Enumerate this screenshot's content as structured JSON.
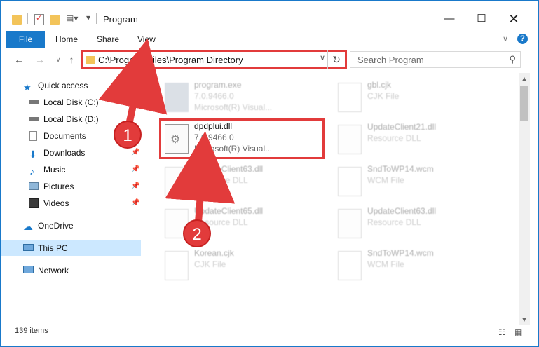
{
  "window": {
    "title": "Program"
  },
  "ribbon": {
    "tabs": [
      "File",
      "Home",
      "Share",
      "View"
    ]
  },
  "address": {
    "path": "C:\\Program Files\\Program Directory"
  },
  "search": {
    "placeholder": "Search Program"
  },
  "nav": {
    "items": [
      {
        "label": "Quick access",
        "icon": "star-icon"
      },
      {
        "label": "Local Disk (C:)",
        "icon": "drive-icon"
      },
      {
        "label": "Local Disk (D:)",
        "icon": "drive-icon"
      },
      {
        "label": "Documents",
        "icon": "documents-icon"
      },
      {
        "label": "Downloads",
        "icon": "download-icon"
      },
      {
        "label": "Music",
        "icon": "music-icon"
      },
      {
        "label": "Pictures",
        "icon": "pictures-icon"
      },
      {
        "label": "Videos",
        "icon": "videos-icon"
      },
      {
        "label": "OneDrive",
        "icon": "cloud-icon"
      },
      {
        "label": "This PC",
        "icon": "computer-icon"
      },
      {
        "label": "Network",
        "icon": "network-icon"
      }
    ]
  },
  "files": {
    "left": [
      {
        "name": "program.exe",
        "line1": "7.0.9466.0",
        "line2": "Microsoft(R) Visual..."
      },
      {
        "name": "dpdplui.dll",
        "line1": "7.0.9466.0",
        "line2": "Microsoft(R) Visual..."
      },
      {
        "name": "UpdateClient63.dll",
        "line1": "Resource DLL",
        "line2": ""
      },
      {
        "name": "UpdateClient65.dll",
        "line1": "Resource DLL",
        "line2": ""
      },
      {
        "name": "Korean.cjk",
        "line1": "CJK File",
        "line2": ""
      }
    ],
    "right": [
      {
        "name": "gbl.cjk",
        "line1": "CJK File",
        "line2": ""
      },
      {
        "name": "UpdateClient21.dll",
        "line1": "Resource DLL",
        "line2": ""
      },
      {
        "name": "SndToWP14.wcm",
        "line1": "WCM File",
        "line2": ""
      },
      {
        "name": "UpdateClient63.dll",
        "line1": "Resource DLL",
        "line2": ""
      },
      {
        "name": "SndToWP14.wcm",
        "line1": "WCM File",
        "line2": ""
      }
    ]
  },
  "status": {
    "item_count": "139 items"
  },
  "annotations": {
    "step1": "1",
    "step2": "2"
  },
  "colors": {
    "accent": "#1979ca",
    "highlight": "#e23b3b",
    "selection": "#cce8ff"
  }
}
